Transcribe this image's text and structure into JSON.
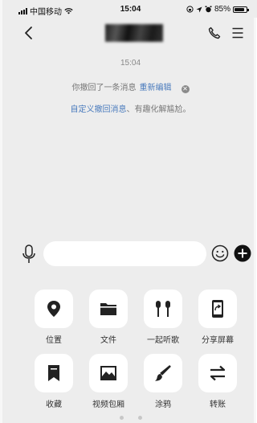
{
  "status_bar": {
    "carrier": "中国移动",
    "time": "15:04",
    "battery_percent": "85%",
    "battery_level": 0.85
  },
  "nav": {
    "back_icon": "chevron-left-icon",
    "call_icon": "phone-icon",
    "menu_icon": "menu-icon"
  },
  "chat": {
    "timestamp": "15:04",
    "recall_notice": "你撤回了一条消息",
    "re_edit_link": "重新编辑",
    "custom_recall_link": "自定义撤回消息",
    "custom_recall_suffix": "、有趣化解尴尬。"
  },
  "input_bar": {
    "placeholder": "",
    "voice_icon": "microphone-icon",
    "emoji_icon": "emoji-icon",
    "plus_icon": "plus-icon"
  },
  "panel": {
    "items": [
      {
        "label": "位置",
        "icon": "location-pin-icon"
      },
      {
        "label": "文件",
        "icon": "folder-icon"
      },
      {
        "label": "一起听歌",
        "icon": "earphones-icon"
      },
      {
        "label": "分享屏幕",
        "icon": "share-screen-icon"
      },
      {
        "label": "收藏",
        "icon": "bookmark-icon"
      },
      {
        "label": "视频包厢",
        "icon": "image-icon"
      },
      {
        "label": "涂鸦",
        "icon": "brush-icon"
      },
      {
        "label": "转账",
        "icon": "transfer-icon"
      }
    ]
  },
  "colors": {
    "background": "#ededed",
    "link": "#4a7bbd",
    "tile": "#ffffff",
    "icon": "#222222"
  }
}
